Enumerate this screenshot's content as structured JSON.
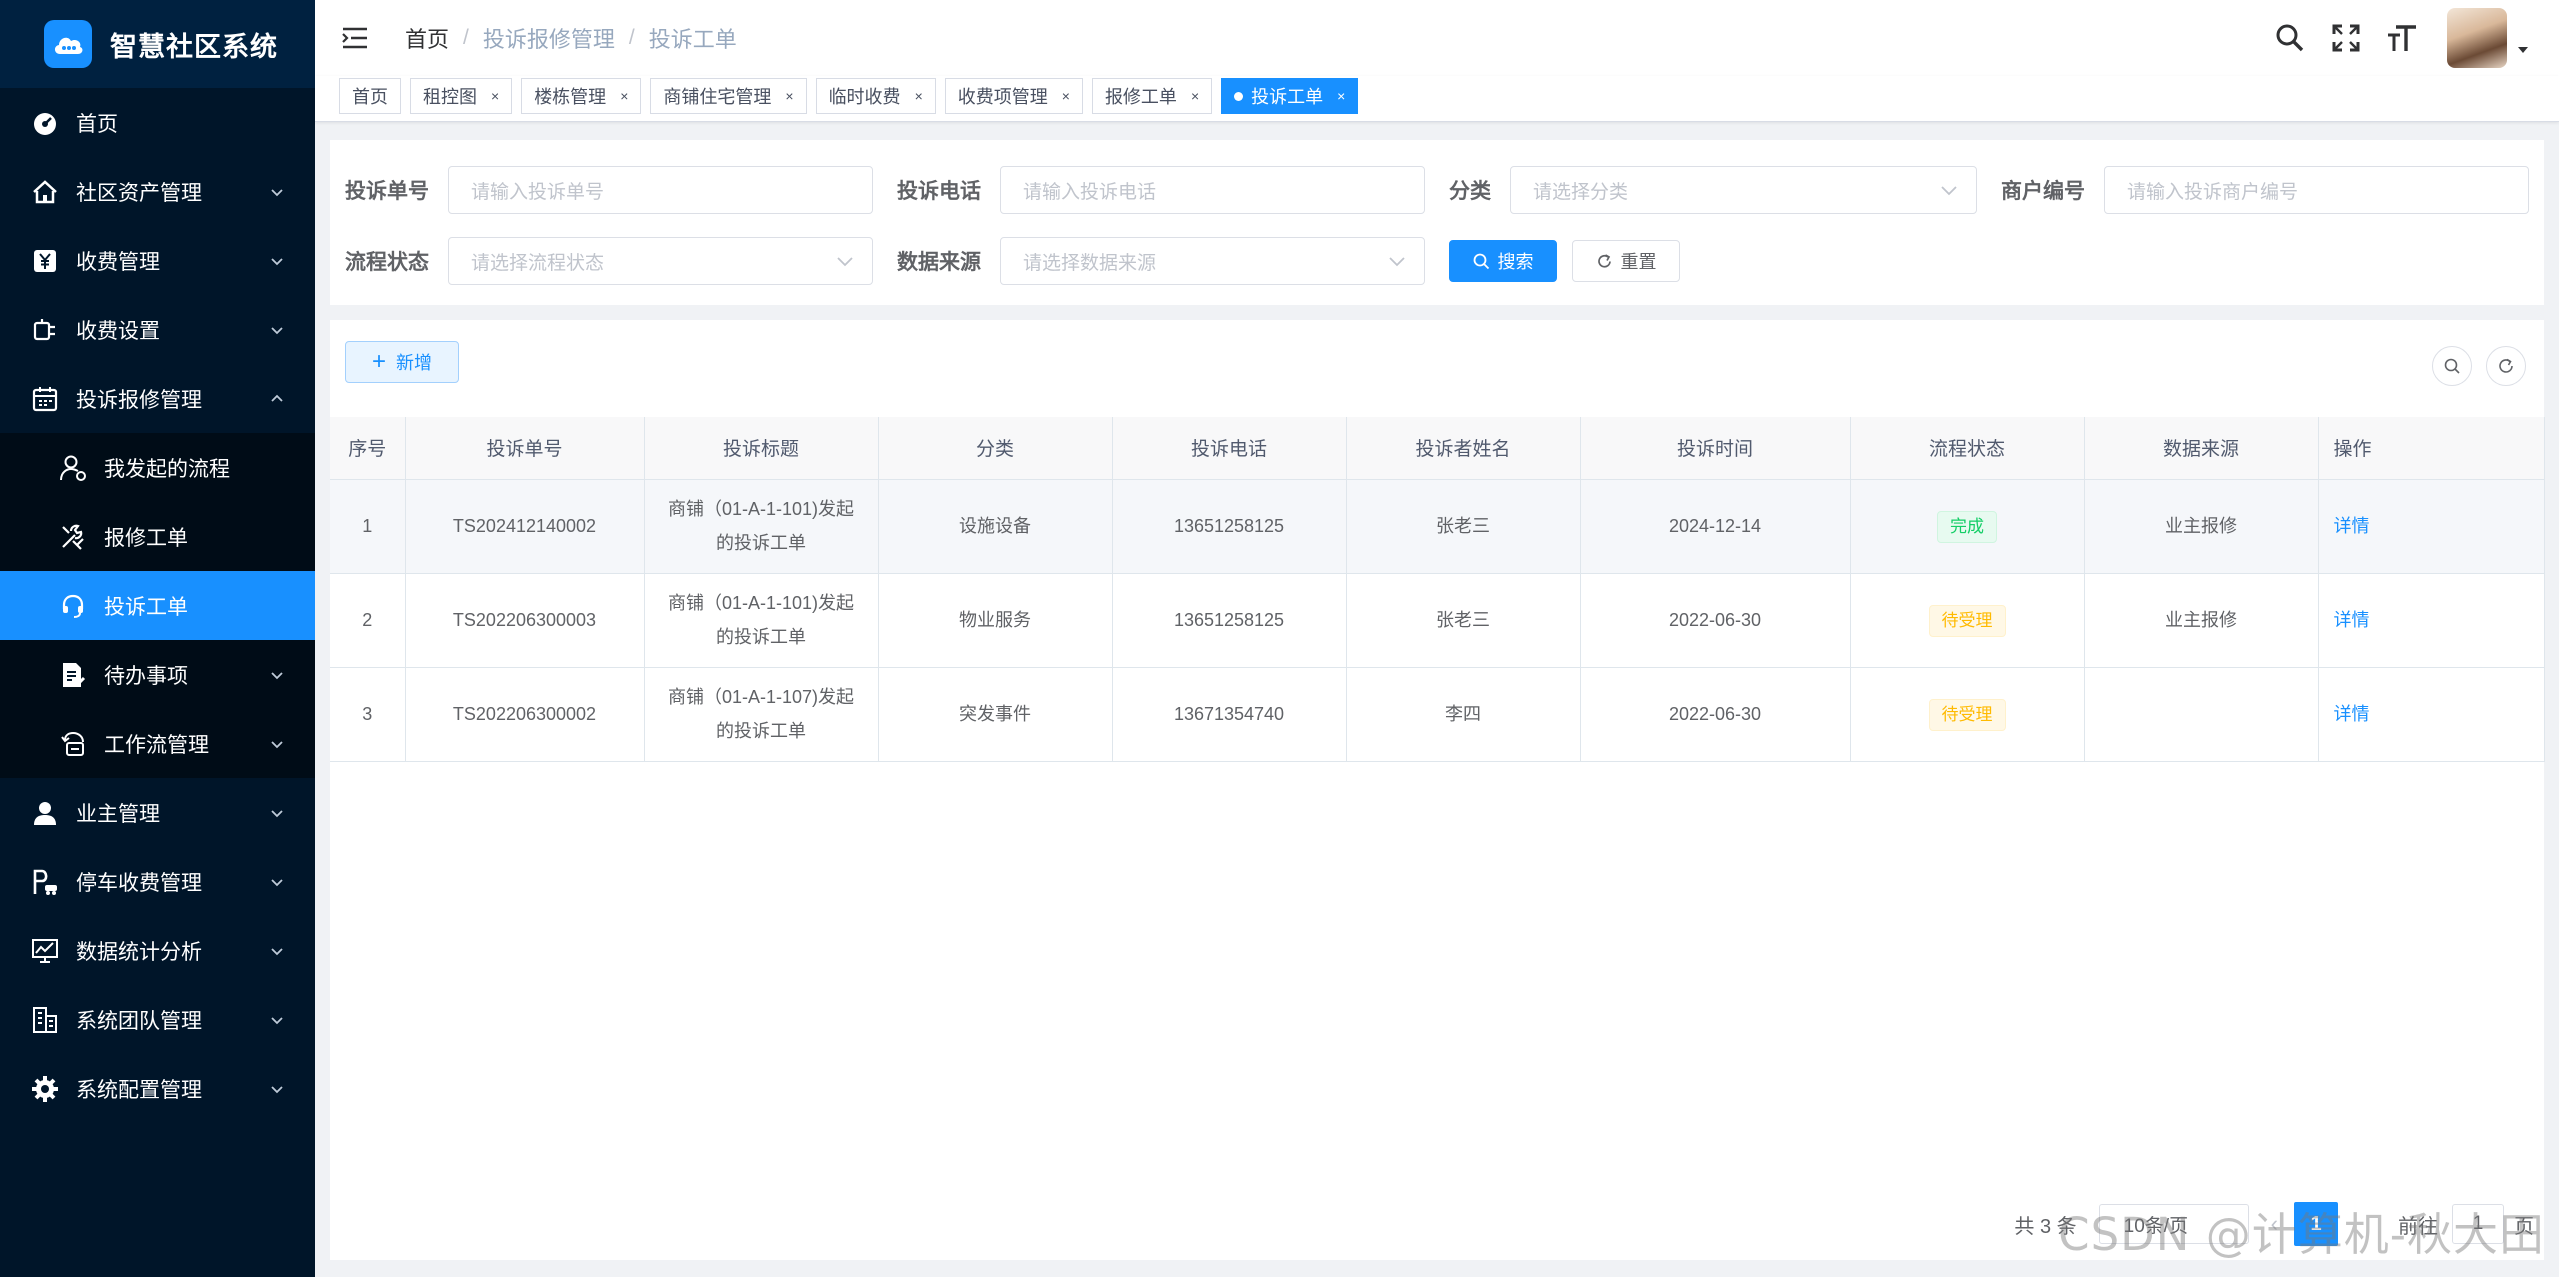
{
  "app": {
    "title": "智慧社区系统"
  },
  "sidebar": {
    "items": [
      {
        "label": "首页"
      },
      {
        "label": "社区资产管理"
      },
      {
        "label": "收费管理"
      },
      {
        "label": "收费设置"
      },
      {
        "label": "投诉报修管理"
      },
      {
        "label": "我发起的流程"
      },
      {
        "label": "报修工单"
      },
      {
        "label": "投诉工单"
      },
      {
        "label": "待办事项"
      },
      {
        "label": "工作流管理"
      },
      {
        "label": "业主管理"
      },
      {
        "label": "停车收费管理"
      },
      {
        "label": "数据统计分析"
      },
      {
        "label": "系统团队管理"
      },
      {
        "label": "系统配置管理"
      }
    ]
  },
  "breadcrumb": [
    "首页",
    "投诉报修管理",
    "投诉工单"
  ],
  "tags": [
    {
      "label": "首页"
    },
    {
      "label": "租控图",
      "close": "×"
    },
    {
      "label": "楼栋管理",
      "close": "×"
    },
    {
      "label": "商铺住宅管理",
      "close": "×"
    },
    {
      "label": "临时收费",
      "close": "×"
    },
    {
      "label": "收费项管理",
      "close": "×"
    },
    {
      "label": "报修工单",
      "close": "×"
    },
    {
      "label": "投诉工单",
      "close": "×"
    }
  ],
  "search": {
    "complaint_no": {
      "label": "投诉单号",
      "placeholder": "请输入投诉单号"
    },
    "complaint_phone": {
      "label": "投诉电话",
      "placeholder": "请输入投诉电话"
    },
    "category": {
      "label": "分类",
      "placeholder": "请选择分类"
    },
    "merchant_no": {
      "label": "商户编号",
      "placeholder": "请输入投诉商户编号"
    },
    "flow_status": {
      "label": "流程状态",
      "placeholder": "请选择流程状态"
    },
    "data_source": {
      "label": "数据来源",
      "placeholder": "请选择数据来源"
    },
    "search_label": "搜索",
    "reset_label": "重置"
  },
  "toolbar": {
    "add_label": "新增"
  },
  "table": {
    "columns": [
      "序号",
      "投诉单号",
      "投诉标题",
      "分类",
      "投诉电话",
      "投诉者姓名",
      "投诉时间",
      "流程状态",
      "数据来源",
      "操作"
    ],
    "rows": [
      {
        "index": "1",
        "no": "TS202412140002",
        "title": "商铺（01-A-1-101)发起的投诉工单",
        "category": "设施设备",
        "phone": "13651258125",
        "name": "张老三",
        "time": "2024-12-14",
        "status": "完成",
        "status_type": "done",
        "source": "业主报修",
        "action": "详情"
      },
      {
        "index": "2",
        "no": "TS202206300003",
        "title": "商铺（01-A-1-101)发起的投诉工单",
        "category": "物业服务",
        "phone": "13651258125",
        "name": "张老三",
        "time": "2022-06-30",
        "status": "待受理",
        "status_type": "wait",
        "source": "业主报修",
        "action": "详情"
      },
      {
        "index": "3",
        "no": "TS202206300002",
        "title": "商铺（01-A-1-107)发起的投诉工单",
        "category": "突发事件",
        "phone": "13671354740",
        "name": "李四",
        "time": "2022-06-30",
        "status": "待受理",
        "status_type": "wait",
        "source": "",
        "action": "详情"
      }
    ]
  },
  "pagination": {
    "total": "共 3 条",
    "page_size": "10条/页",
    "prev": "‹",
    "current": "1",
    "goto": "前往",
    "jump_value": "1",
    "page_suffix": "页"
  },
  "watermark": "CSDN @计算机-秋大田",
  "colors": {
    "primary": "#1890ff",
    "sidebar": "#001529",
    "success": "#13ce66",
    "warning": "#ffba00"
  }
}
